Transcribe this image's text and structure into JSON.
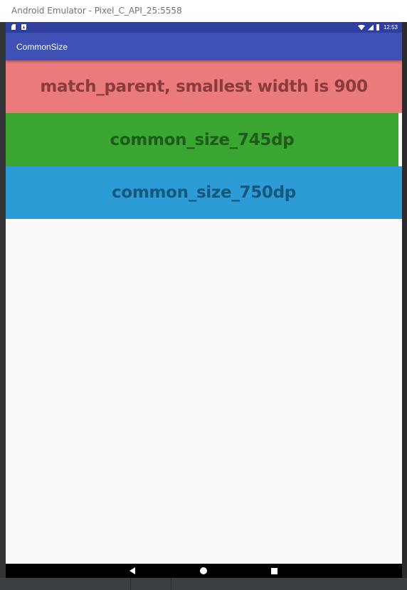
{
  "window": {
    "title": "Android Emulator - Pixel_C_API_25:5558"
  },
  "status_bar": {
    "time": "12:53",
    "icons_left": [
      "sd-card-icon",
      "android-notification-icon"
    ],
    "icons_right": [
      "wifi-icon",
      "signal-icon",
      "battery-icon"
    ]
  },
  "app_bar": {
    "title": "CommonSize"
  },
  "blocks": [
    {
      "label": "match_parent, smallest width is 900",
      "background": "#ea7a7b",
      "text_color": "#8c3b3c"
    },
    {
      "label": "common_size_745dp",
      "background": "#3ba532",
      "text_color": "#1f5b1a"
    },
    {
      "label": "common_size_750dp",
      "background": "#2c9bd6",
      "text_color": "#14587b"
    }
  ],
  "nav_bar": {
    "buttons": [
      "back-icon",
      "home-icon",
      "recents-icon"
    ]
  },
  "colors": {
    "status_bar": "#303f9f",
    "app_bar": "#3f51b5",
    "content_background": "#fafafa"
  }
}
